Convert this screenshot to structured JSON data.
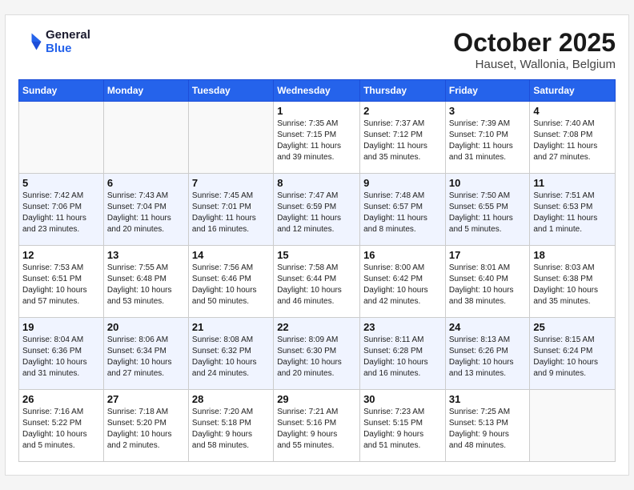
{
  "header": {
    "logo_line1": "General",
    "logo_line2": "Blue",
    "month": "October 2025",
    "location": "Hauset, Wallonia, Belgium"
  },
  "days": [
    "Sunday",
    "Monday",
    "Tuesday",
    "Wednesday",
    "Thursday",
    "Friday",
    "Saturday"
  ],
  "weeks": [
    [
      {
        "day": "",
        "text": ""
      },
      {
        "day": "",
        "text": ""
      },
      {
        "day": "",
        "text": ""
      },
      {
        "day": "1",
        "text": "Sunrise: 7:35 AM\nSunset: 7:15 PM\nDaylight: 11 hours\nand 39 minutes."
      },
      {
        "day": "2",
        "text": "Sunrise: 7:37 AM\nSunset: 7:12 PM\nDaylight: 11 hours\nand 35 minutes."
      },
      {
        "day": "3",
        "text": "Sunrise: 7:39 AM\nSunset: 7:10 PM\nDaylight: 11 hours\nand 31 minutes."
      },
      {
        "day": "4",
        "text": "Sunrise: 7:40 AM\nSunset: 7:08 PM\nDaylight: 11 hours\nand 27 minutes."
      }
    ],
    [
      {
        "day": "5",
        "text": "Sunrise: 7:42 AM\nSunset: 7:06 PM\nDaylight: 11 hours\nand 23 minutes."
      },
      {
        "day": "6",
        "text": "Sunrise: 7:43 AM\nSunset: 7:04 PM\nDaylight: 11 hours\nand 20 minutes."
      },
      {
        "day": "7",
        "text": "Sunrise: 7:45 AM\nSunset: 7:01 PM\nDaylight: 11 hours\nand 16 minutes."
      },
      {
        "day": "8",
        "text": "Sunrise: 7:47 AM\nSunset: 6:59 PM\nDaylight: 11 hours\nand 12 minutes."
      },
      {
        "day": "9",
        "text": "Sunrise: 7:48 AM\nSunset: 6:57 PM\nDaylight: 11 hours\nand 8 minutes."
      },
      {
        "day": "10",
        "text": "Sunrise: 7:50 AM\nSunset: 6:55 PM\nDaylight: 11 hours\nand 5 minutes."
      },
      {
        "day": "11",
        "text": "Sunrise: 7:51 AM\nSunset: 6:53 PM\nDaylight: 11 hours\nand 1 minute."
      }
    ],
    [
      {
        "day": "12",
        "text": "Sunrise: 7:53 AM\nSunset: 6:51 PM\nDaylight: 10 hours\nand 57 minutes."
      },
      {
        "day": "13",
        "text": "Sunrise: 7:55 AM\nSunset: 6:48 PM\nDaylight: 10 hours\nand 53 minutes."
      },
      {
        "day": "14",
        "text": "Sunrise: 7:56 AM\nSunset: 6:46 PM\nDaylight: 10 hours\nand 50 minutes."
      },
      {
        "day": "15",
        "text": "Sunrise: 7:58 AM\nSunset: 6:44 PM\nDaylight: 10 hours\nand 46 minutes."
      },
      {
        "day": "16",
        "text": "Sunrise: 8:00 AM\nSunset: 6:42 PM\nDaylight: 10 hours\nand 42 minutes."
      },
      {
        "day": "17",
        "text": "Sunrise: 8:01 AM\nSunset: 6:40 PM\nDaylight: 10 hours\nand 38 minutes."
      },
      {
        "day": "18",
        "text": "Sunrise: 8:03 AM\nSunset: 6:38 PM\nDaylight: 10 hours\nand 35 minutes."
      }
    ],
    [
      {
        "day": "19",
        "text": "Sunrise: 8:04 AM\nSunset: 6:36 PM\nDaylight: 10 hours\nand 31 minutes."
      },
      {
        "day": "20",
        "text": "Sunrise: 8:06 AM\nSunset: 6:34 PM\nDaylight: 10 hours\nand 27 minutes."
      },
      {
        "day": "21",
        "text": "Sunrise: 8:08 AM\nSunset: 6:32 PM\nDaylight: 10 hours\nand 24 minutes."
      },
      {
        "day": "22",
        "text": "Sunrise: 8:09 AM\nSunset: 6:30 PM\nDaylight: 10 hours\nand 20 minutes."
      },
      {
        "day": "23",
        "text": "Sunrise: 8:11 AM\nSunset: 6:28 PM\nDaylight: 10 hours\nand 16 minutes."
      },
      {
        "day": "24",
        "text": "Sunrise: 8:13 AM\nSunset: 6:26 PM\nDaylight: 10 hours\nand 13 minutes."
      },
      {
        "day": "25",
        "text": "Sunrise: 8:15 AM\nSunset: 6:24 PM\nDaylight: 10 hours\nand 9 minutes."
      }
    ],
    [
      {
        "day": "26",
        "text": "Sunrise: 7:16 AM\nSunset: 5:22 PM\nDaylight: 10 hours\nand 5 minutes."
      },
      {
        "day": "27",
        "text": "Sunrise: 7:18 AM\nSunset: 5:20 PM\nDaylight: 10 hours\nand 2 minutes."
      },
      {
        "day": "28",
        "text": "Sunrise: 7:20 AM\nSunset: 5:18 PM\nDaylight: 9 hours\nand 58 minutes."
      },
      {
        "day": "29",
        "text": "Sunrise: 7:21 AM\nSunset: 5:16 PM\nDaylight: 9 hours\nand 55 minutes."
      },
      {
        "day": "30",
        "text": "Sunrise: 7:23 AM\nSunset: 5:15 PM\nDaylight: 9 hours\nand 51 minutes."
      },
      {
        "day": "31",
        "text": "Sunrise: 7:25 AM\nSunset: 5:13 PM\nDaylight: 9 hours\nand 48 minutes."
      },
      {
        "day": "",
        "text": ""
      }
    ]
  ]
}
